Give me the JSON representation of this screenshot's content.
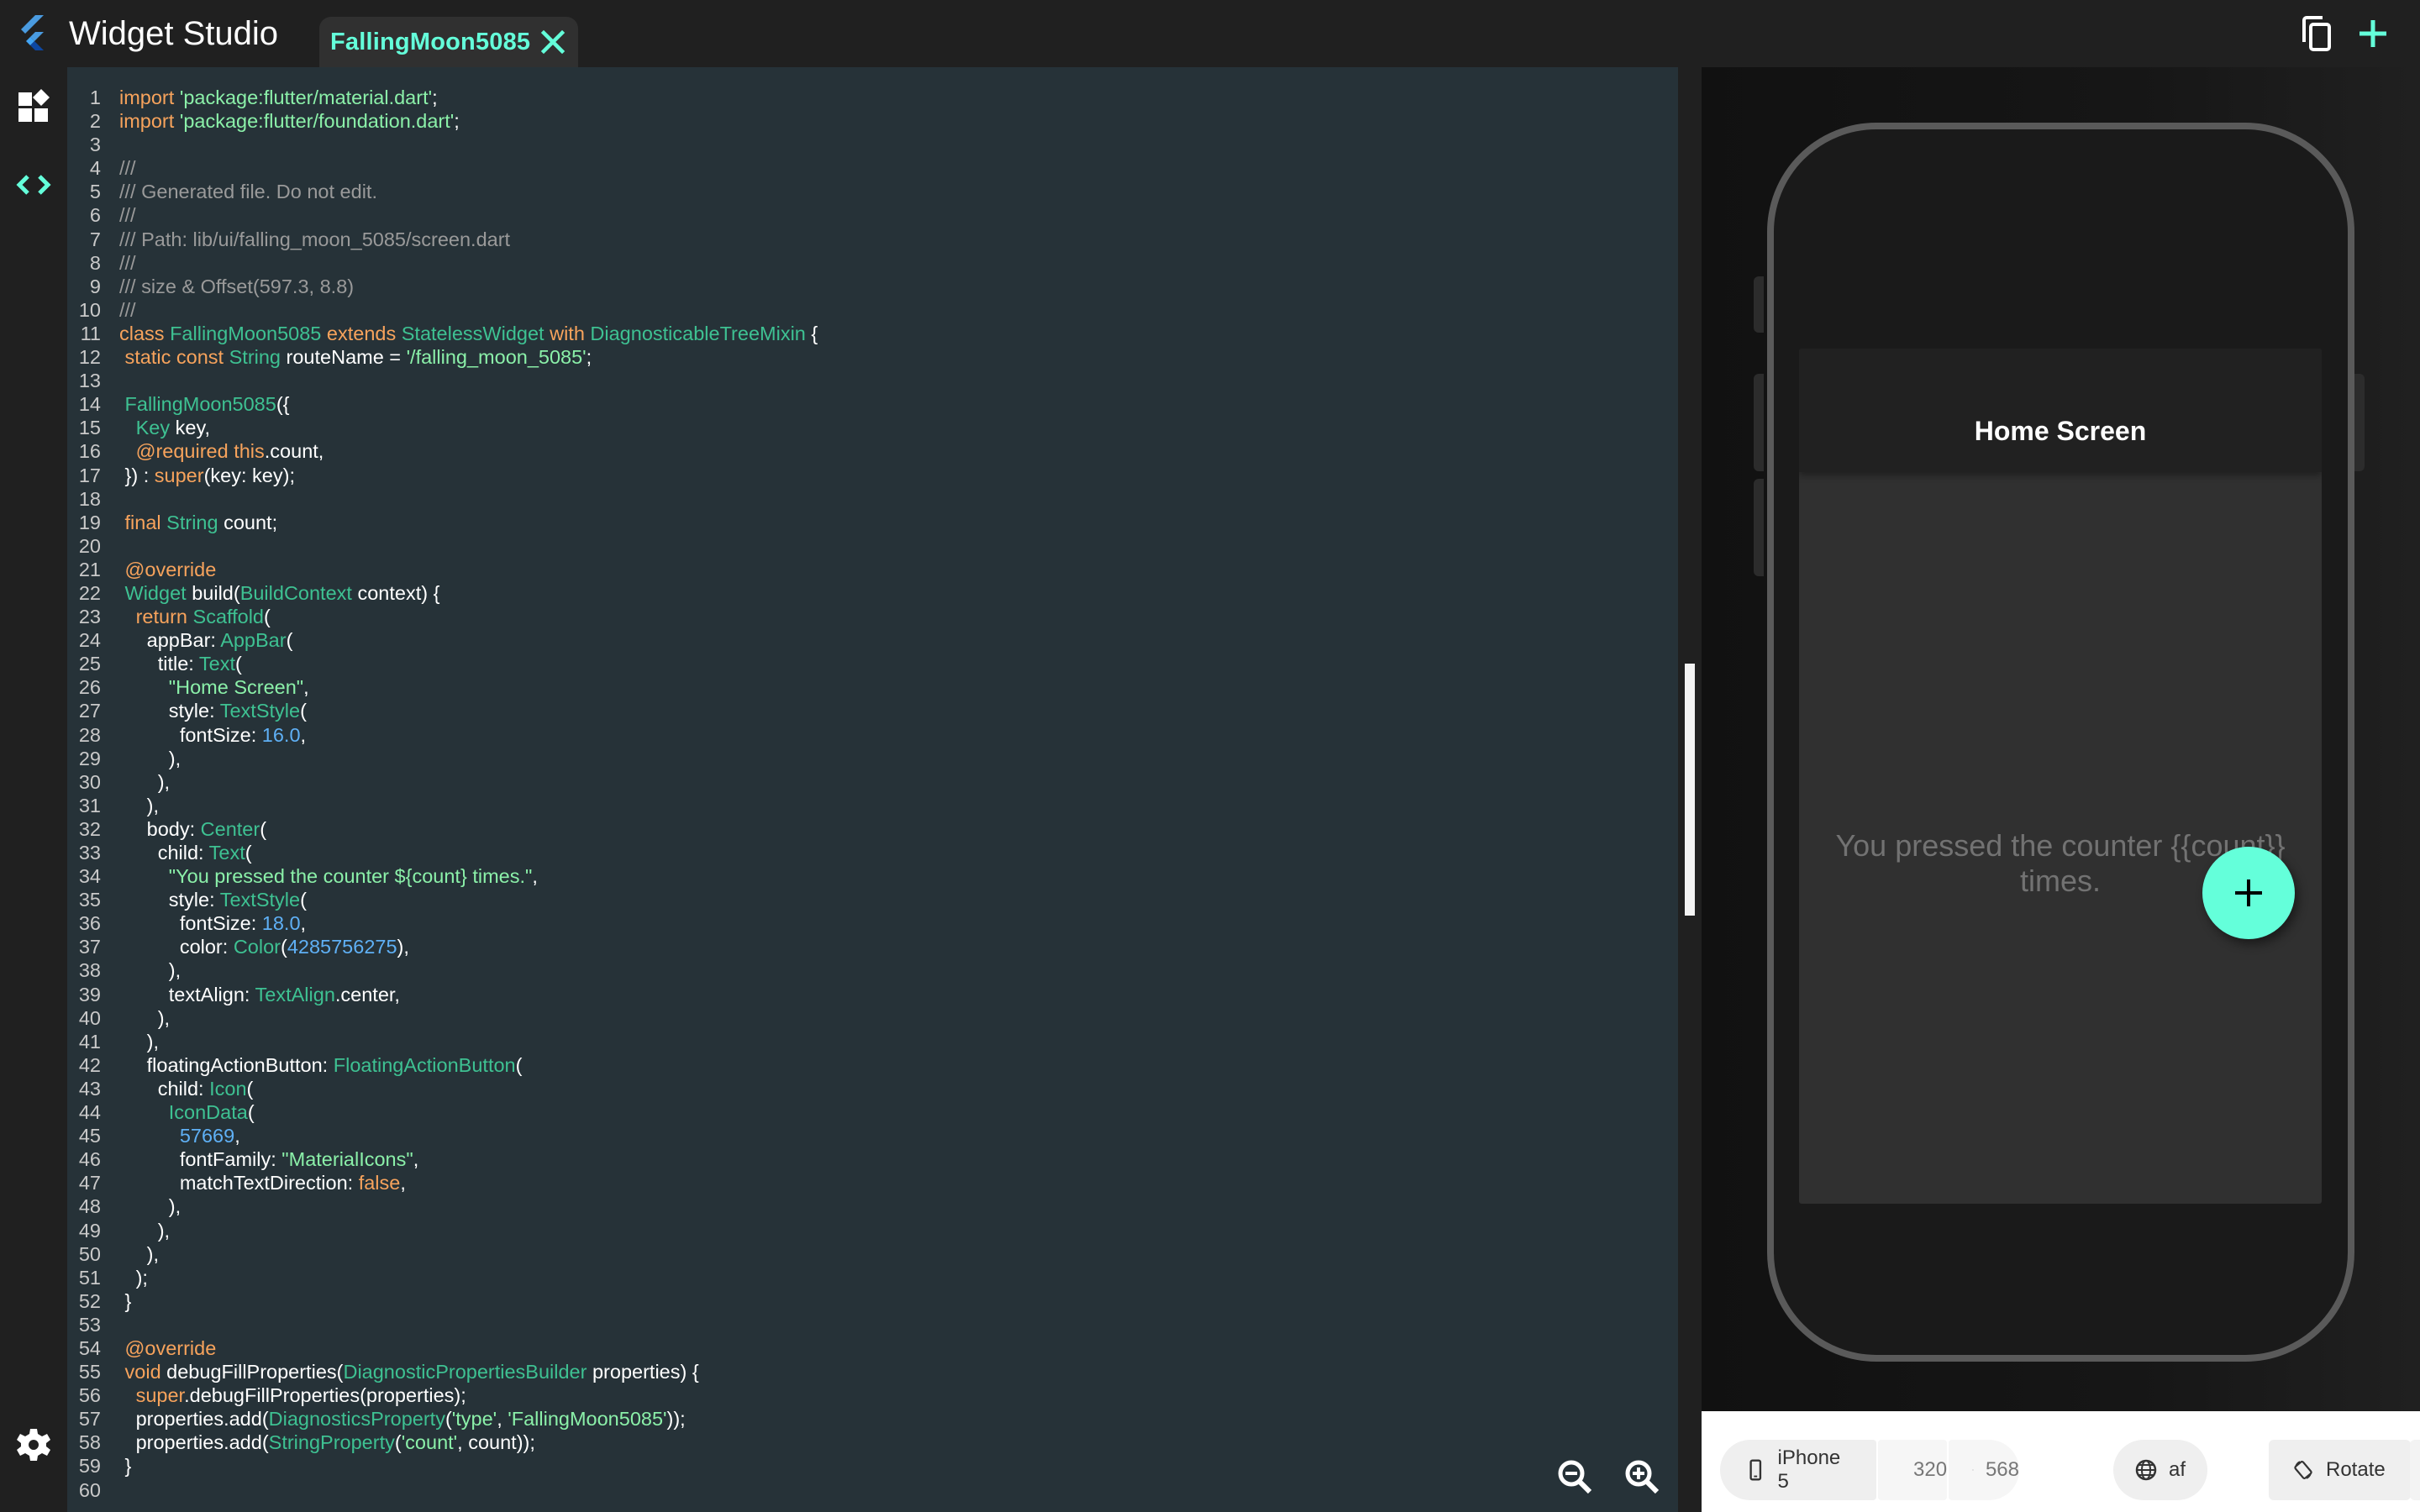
{
  "header": {
    "app_title": "Widget Studio",
    "tab_label": "FallingMoon5085",
    "tab_close_icon": "close-icon",
    "actions": [
      {
        "name": "copy",
        "icon": "copy-icon"
      },
      {
        "name": "add",
        "icon": "plus-icon"
      }
    ]
  },
  "sidebar": {
    "items": [
      {
        "name": "widgets",
        "icon": "widgets-icon",
        "active": false
      },
      {
        "name": "code",
        "icon": "code-icon",
        "active": true
      }
    ],
    "settings_icon": "gear-icon"
  },
  "colors": {
    "accent": "#64FFDA",
    "editor_bg": "#263238",
    "keyword": "#F7A35C",
    "type": "#3EC192",
    "string": "#8BF0A9",
    "comment": "#9A9A9A",
    "number": "#5FB0F5"
  },
  "editor": {
    "lines": [
      [
        [
          "kw",
          "import "
        ],
        [
          "st",
          "'package:flutter/material.dart'"
        ],
        [
          "pl",
          ";"
        ]
      ],
      [
        [
          "kw",
          "import "
        ],
        [
          "st",
          "'package:flutter/foundation.dart'"
        ],
        [
          "pl",
          ";"
        ]
      ],
      [],
      [
        [
          "cm",
          "///"
        ]
      ],
      [
        [
          "cm",
          "/// Generated file. Do not edit."
        ]
      ],
      [
        [
          "cm",
          "///"
        ]
      ],
      [
        [
          "cm",
          "/// Path: lib/ui/falling_moon_5085/screen.dart"
        ]
      ],
      [
        [
          "cm",
          "///"
        ]
      ],
      [
        [
          "cm",
          "/// size & Offset(597.3, 8.8)"
        ]
      ],
      [
        [
          "cm",
          "///"
        ]
      ],
      [
        [
          "kw",
          "class "
        ],
        [
          "ty",
          "FallingMoon5085 "
        ],
        [
          "kw",
          "extends "
        ],
        [
          "ty",
          "StatelessWidget "
        ],
        [
          "kw",
          "with "
        ],
        [
          "ty",
          "DiagnosticableTreeMixin "
        ],
        [
          "pl",
          "{"
        ]
      ],
      [
        [
          "pl",
          " "
        ],
        [
          "kw",
          "static const "
        ],
        [
          "ty",
          "String "
        ],
        [
          "pl",
          "routeName = "
        ],
        [
          "st",
          "'/falling_moon_5085'"
        ],
        [
          "pl",
          ";"
        ]
      ],
      [],
      [
        [
          "pl",
          " "
        ],
        [
          "ty",
          "FallingMoon5085"
        ],
        [
          "pl",
          "({"
        ]
      ],
      [
        [
          "pl",
          "   "
        ],
        [
          "ty",
          "Key "
        ],
        [
          "pl",
          "key,"
        ]
      ],
      [
        [
          "pl",
          "   "
        ],
        [
          "kw",
          "@required this"
        ],
        [
          "pl",
          ".count,"
        ]
      ],
      [
        [
          "pl",
          " }) : "
        ],
        [
          "kw",
          "super"
        ],
        [
          "pl",
          "(key: key);"
        ]
      ],
      [],
      [
        [
          "pl",
          " "
        ],
        [
          "kw",
          "final "
        ],
        [
          "ty",
          "String "
        ],
        [
          "pl",
          "count;"
        ]
      ],
      [],
      [
        [
          "pl",
          " "
        ],
        [
          "kw",
          "@override"
        ]
      ],
      [
        [
          "pl",
          " "
        ],
        [
          "ty",
          "Widget "
        ],
        [
          "pl",
          "build("
        ],
        [
          "ty",
          "BuildContext "
        ],
        [
          "pl",
          "context) {"
        ]
      ],
      [
        [
          "pl",
          "   "
        ],
        [
          "kw",
          "return "
        ],
        [
          "ty",
          "Scaffold"
        ],
        [
          "pl",
          "("
        ]
      ],
      [
        [
          "pl",
          "     appBar: "
        ],
        [
          "ty",
          "AppBar"
        ],
        [
          "pl",
          "("
        ]
      ],
      [
        [
          "pl",
          "       title: "
        ],
        [
          "ty",
          "Text"
        ],
        [
          "pl",
          "("
        ]
      ],
      [
        [
          "pl",
          "         "
        ],
        [
          "st",
          "\"Home Screen\""
        ],
        [
          "pl",
          ","
        ]
      ],
      [
        [
          "pl",
          "         style: "
        ],
        [
          "ty",
          "TextStyle"
        ],
        [
          "pl",
          "("
        ]
      ],
      [
        [
          "pl",
          "           fontSize: "
        ],
        [
          "nu",
          "16.0"
        ],
        [
          "pl",
          ","
        ]
      ],
      [
        [
          "pl",
          "         ),"
        ]
      ],
      [
        [
          "pl",
          "       ),"
        ]
      ],
      [
        [
          "pl",
          "     ),"
        ]
      ],
      [
        [
          "pl",
          "     body: "
        ],
        [
          "ty",
          "Center"
        ],
        [
          "pl",
          "("
        ]
      ],
      [
        [
          "pl",
          "       child: "
        ],
        [
          "ty",
          "Text"
        ],
        [
          "pl",
          "("
        ]
      ],
      [
        [
          "pl",
          "         "
        ],
        [
          "st",
          "\"You pressed the counter ${count} times.\""
        ],
        [
          "pl",
          ","
        ]
      ],
      [
        [
          "pl",
          "         style: "
        ],
        [
          "ty",
          "TextStyle"
        ],
        [
          "pl",
          "("
        ]
      ],
      [
        [
          "pl",
          "           fontSize: "
        ],
        [
          "nu",
          "18.0"
        ],
        [
          "pl",
          ","
        ]
      ],
      [
        [
          "pl",
          "           color: "
        ],
        [
          "ty",
          "Color"
        ],
        [
          "pl",
          "("
        ],
        [
          "nu",
          "4285756275"
        ],
        [
          "pl",
          "),"
        ]
      ],
      [
        [
          "pl",
          "         ),"
        ]
      ],
      [
        [
          "pl",
          "         textAlign: "
        ],
        [
          "ty",
          "TextAlign"
        ],
        [
          "pl",
          ".center,"
        ]
      ],
      [
        [
          "pl",
          "       ),"
        ]
      ],
      [
        [
          "pl",
          "     ),"
        ]
      ],
      [
        [
          "pl",
          "     floatingActionButton: "
        ],
        [
          "ty",
          "FloatingActionButton"
        ],
        [
          "pl",
          "("
        ]
      ],
      [
        [
          "pl",
          "       child: "
        ],
        [
          "ty",
          "Icon"
        ],
        [
          "pl",
          "("
        ]
      ],
      [
        [
          "pl",
          "         "
        ],
        [
          "ty",
          "IconData"
        ],
        [
          "pl",
          "("
        ]
      ],
      [
        [
          "pl",
          "           "
        ],
        [
          "nu",
          "57669"
        ],
        [
          "pl",
          ","
        ]
      ],
      [
        [
          "pl",
          "           fontFamily: "
        ],
        [
          "st",
          "\"MaterialIcons\""
        ],
        [
          "pl",
          ","
        ]
      ],
      [
        [
          "pl",
          "           matchTextDirection: "
        ],
        [
          "kw",
          "false"
        ],
        [
          "pl",
          ","
        ]
      ],
      [
        [
          "pl",
          "         ),"
        ]
      ],
      [
        [
          "pl",
          "       ),"
        ]
      ],
      [
        [
          "pl",
          "     ),"
        ]
      ],
      [
        [
          "pl",
          "   );"
        ]
      ],
      [
        [
          "pl",
          " }"
        ]
      ],
      [],
      [
        [
          "pl",
          " "
        ],
        [
          "kw",
          "@override"
        ]
      ],
      [
        [
          "pl",
          " "
        ],
        [
          "kw",
          "void "
        ],
        [
          "pl",
          "debugFillProperties("
        ],
        [
          "ty",
          "DiagnosticPropertiesBuilder "
        ],
        [
          "pl",
          "properties) {"
        ]
      ],
      [
        [
          "pl",
          "   "
        ],
        [
          "kw",
          "super"
        ],
        [
          "pl",
          ".debugFillProperties(properties);"
        ]
      ],
      [
        [
          "pl",
          "   properties.add("
        ],
        [
          "ty",
          "DiagnosticsProperty"
        ],
        [
          "pl",
          "("
        ],
        [
          "st",
          "'type'"
        ],
        [
          "pl",
          ", "
        ],
        [
          "st",
          "'FallingMoon5085'"
        ],
        [
          "pl",
          "));"
        ]
      ],
      [
        [
          "pl",
          "   properties.add("
        ],
        [
          "ty",
          "StringProperty"
        ],
        [
          "pl",
          "("
        ],
        [
          "st",
          "'count'"
        ],
        [
          "pl",
          ", count));"
        ]
      ],
      [
        [
          "pl",
          " }"
        ]
      ],
      []
    ],
    "zoom_out_icon": "zoom-out-icon",
    "zoom_in_icon": "zoom-in-icon"
  },
  "preview": {
    "appbar_title": "Home Screen",
    "body_text": "You pressed the counter {{count}} times.",
    "fab_icon": "plus-icon"
  },
  "toolbar": {
    "device": "iPhone 5",
    "width": "320",
    "height": "568",
    "locale": "af",
    "rotate": "Rotate"
  }
}
